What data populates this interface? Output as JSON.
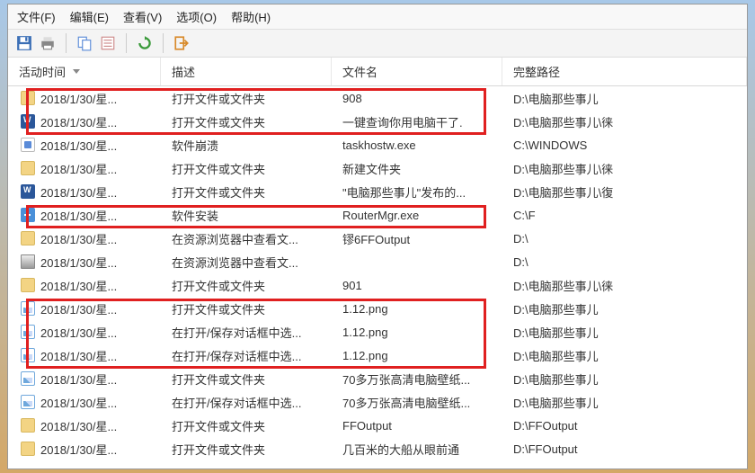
{
  "menu": {
    "file": "文件(F)",
    "edit": "编辑(E)",
    "view": "查看(V)",
    "options": "选项(O)",
    "help": "帮助(H)"
  },
  "toolbar_icons": {
    "save": "save-icon",
    "print": "print-icon",
    "copy": "copy-icon",
    "props": "properties-icon",
    "refresh": "refresh-icon",
    "exit": "exit-icon"
  },
  "columns": {
    "c0": "活动时间",
    "c1": "描述",
    "c2": "文件名",
    "c3": "完整路径"
  },
  "rows": [
    {
      "icon": "folder",
      "time": "2018/1/30/星...",
      "desc": "打开文件或文件夹",
      "file": "908",
      "path": "D:\\电脑那些事儿"
    },
    {
      "icon": "word",
      "time": "2018/1/30/星...",
      "desc": "打开文件或文件夹",
      "file": "一键查询你用电脑干了.",
      "path": "D:\\电脑那些事儿\\徕"
    },
    {
      "icon": "exe",
      "time": "2018/1/30/星...",
      "desc": "软件崩溃",
      "file": "taskhostw.exe",
      "path": "C:\\WINDOWS"
    },
    {
      "icon": "folder",
      "time": "2018/1/30/星...",
      "desc": "打开文件或文件夹",
      "file": "新建文件夹",
      "path": "D:\\电脑那些事儿\\徕"
    },
    {
      "icon": "word",
      "time": "2018/1/30/星...",
      "desc": "打开文件或文件夹",
      "file": "\"电脑那些事儿\"发布的...",
      "path": "D:\\电脑那些事儿\\復"
    },
    {
      "icon": "install",
      "time": "2018/1/30/星...",
      "desc": "软件安装",
      "file": "RouterMgr.exe",
      "path": "C:\\F"
    },
    {
      "icon": "folder",
      "time": "2018/1/30/星...",
      "desc": "在资源浏览器中查看文...",
      "file": "镠6FFOutput",
      "path": "D:\\"
    },
    {
      "icon": "drive",
      "time": "2018/1/30/星...",
      "desc": "在资源浏览器中查看文...",
      "file": "",
      "path": "D:\\"
    },
    {
      "icon": "folder",
      "time": "2018/1/30/星...",
      "desc": "打开文件或文件夹",
      "file": "901",
      "path": "D:\\电脑那些事儿\\徕"
    },
    {
      "icon": "img",
      "time": "2018/1/30/星...",
      "desc": "打开文件或文件夹",
      "file": "1.12.png",
      "path": "D:\\电脑那些事儿"
    },
    {
      "icon": "img",
      "time": "2018/1/30/星...",
      "desc": "在打开/保存对话框中选...",
      "file": "1.12.png",
      "path": "D:\\电脑那些事儿"
    },
    {
      "icon": "img",
      "time": "2018/1/30/星...",
      "desc": "在打开/保存对话框中选...",
      "file": "1.12.png",
      "path": "D:\\电脑那些事儿"
    },
    {
      "icon": "img",
      "time": "2018/1/30/星...",
      "desc": "打开文件或文件夹",
      "file": "70多万张高清电脑壁纸...",
      "path": "D:\\电脑那些事儿"
    },
    {
      "icon": "img",
      "time": "2018/1/30/星...",
      "desc": "在打开/保存对话框中选...",
      "file": "70多万张高清电脑壁纸...",
      "path": "D:\\电脑那些事儿"
    },
    {
      "icon": "folder",
      "time": "2018/1/30/星...",
      "desc": "打开文件或文件夹",
      "file": "FFOutput",
      "path": "D:\\FFOutput"
    },
    {
      "icon": "folder",
      "time": "2018/1/30/星...",
      "desc": "打开文件或文件夹",
      "file": "几百米的大船从眼前通",
      "path": "D:\\FFOutput"
    }
  ]
}
